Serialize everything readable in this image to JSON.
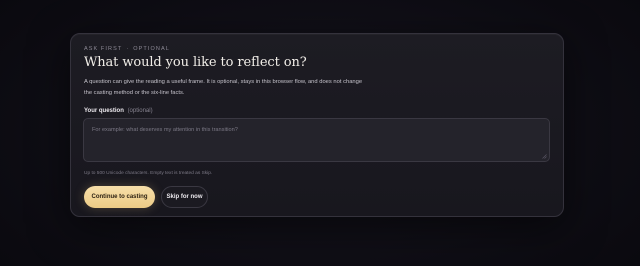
{
  "card": {
    "eyebrow_step": "ASK FIRST",
    "eyebrow_separator": "·",
    "eyebrow_state": "OPTIONAL",
    "title": "What would you like to reflect on?",
    "description": "A question can give the reading a useful frame. It is optional, stays in this browser flow, and does not change the casting method or the six-line facts."
  },
  "question_field": {
    "label": "Your question",
    "optional_label": "(optional)",
    "value": "",
    "placeholder": "For example: what deserves my attention in this transition?",
    "hint": "Up to 500 Unicode characters. Empty text is treated as Skip."
  },
  "actions": {
    "primary_label": "Continue to casting",
    "secondary_label": "Skip for now"
  },
  "colors": {
    "accent": "#eccb86",
    "card_background": "#1b1a21",
    "page_background": "#0e0d14"
  },
  "icons": {
    "textarea_resize": "resize-handle-icon"
  }
}
